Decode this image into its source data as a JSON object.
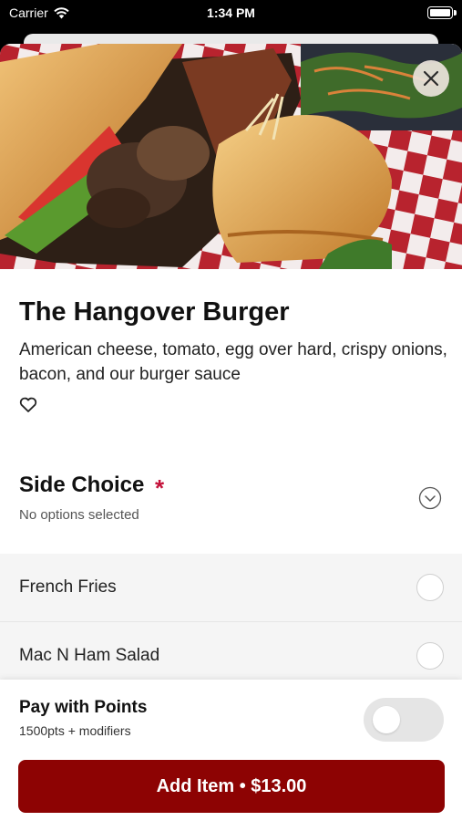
{
  "status_bar": {
    "carrier": "Carrier",
    "time": "1:34 PM"
  },
  "item": {
    "title": "The Hangover Burger",
    "description": "American cheese, tomato, egg over hard, crispy onions, bacon, and our burger sauce"
  },
  "side_choice": {
    "title": "Side Choice",
    "required_mark": "*",
    "subtitle": "No options selected",
    "options": [
      {
        "label": "French Fries",
        "selected": false
      },
      {
        "label": "Mac N Ham Salad",
        "selected": false
      }
    ]
  },
  "pay_with_points": {
    "title": "Pay with Points",
    "subtitle": "1500pts + modifiers",
    "enabled": false
  },
  "add_button": {
    "label": "Add Item • $13.00"
  },
  "colors": {
    "brand": "#8d0303",
    "required": "#c4123a"
  }
}
